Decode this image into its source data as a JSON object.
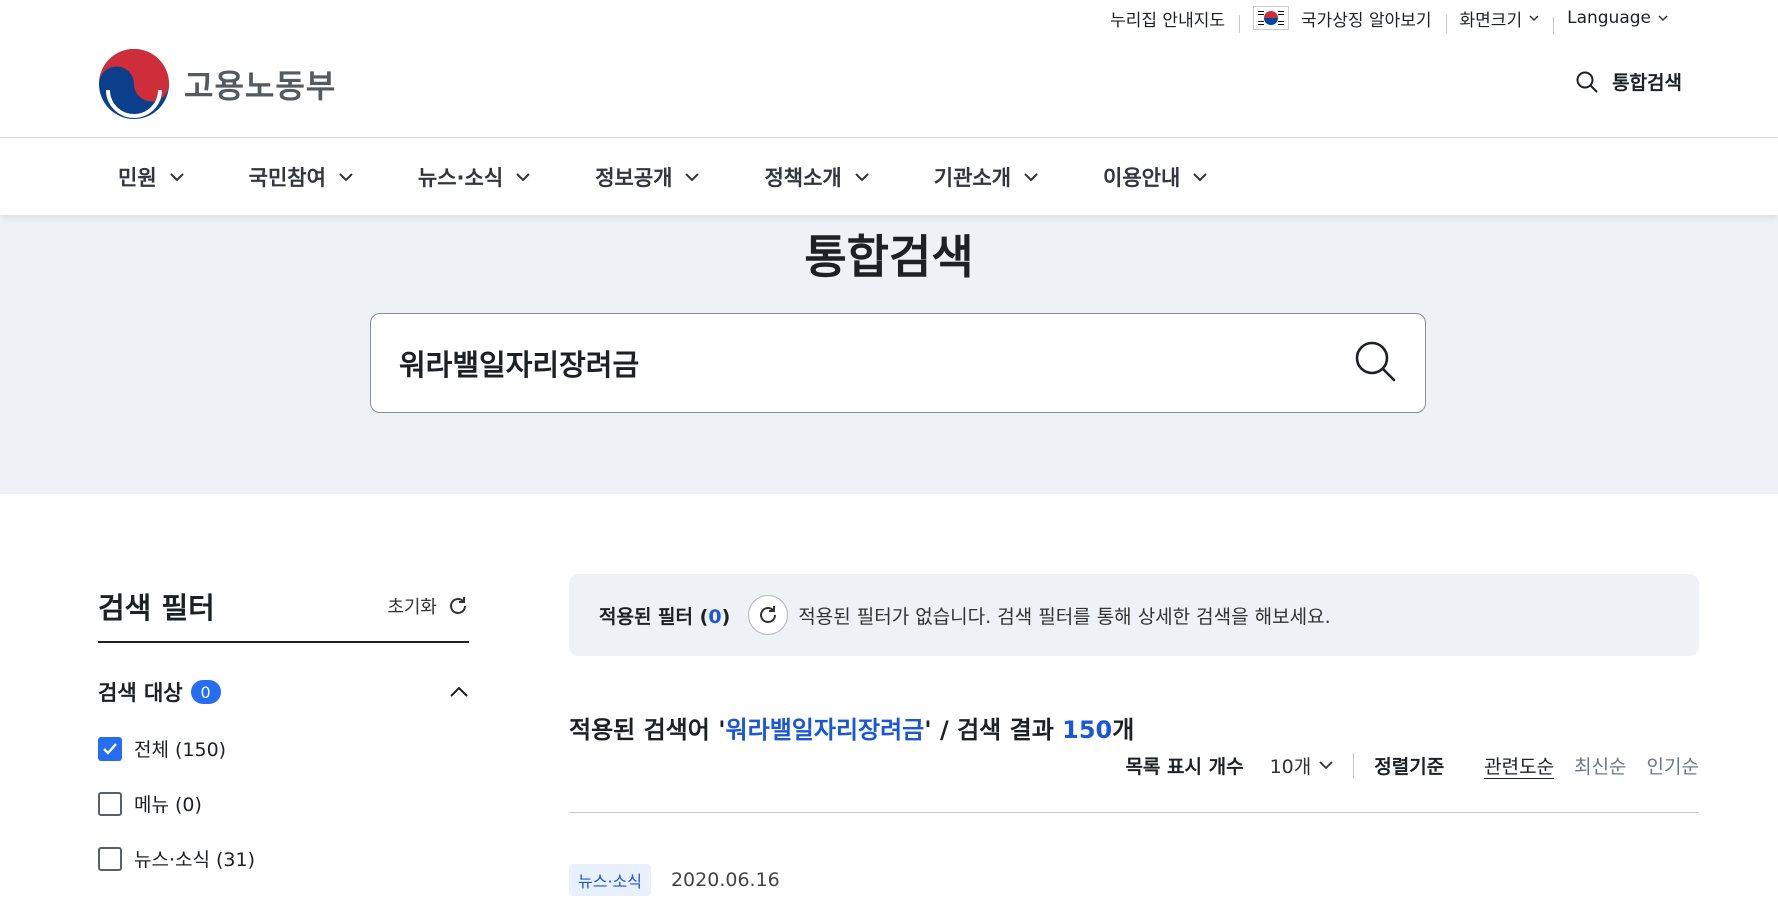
{
  "utility": {
    "sitemap": "누리집 안내지도",
    "symbols": "국가상징 알아보기",
    "font_size": "화면크기",
    "language": "Language"
  },
  "header": {
    "logo_text": "고용노동부",
    "search_label": "통합검색"
  },
  "gnb": [
    {
      "label": "민원"
    },
    {
      "label": "국민참여"
    },
    {
      "label": "뉴스·소식"
    },
    {
      "label": "정보공개"
    },
    {
      "label": "정책소개"
    },
    {
      "label": "기관소개"
    },
    {
      "label": "이용안내"
    }
  ],
  "hero": {
    "title": "통합검색",
    "query": "워라밸일자리장려금"
  },
  "sidebar": {
    "title": "검색 필터",
    "reset_label": "초기화",
    "section_title": "검색 대상",
    "section_count": "0",
    "options": [
      {
        "label": "전체 (150)",
        "checked": true
      },
      {
        "label": "메뉴 (0)",
        "checked": false
      },
      {
        "label": "뉴스·소식 (31)",
        "checked": false
      }
    ]
  },
  "applied": {
    "label_prefix": "적용된 필터 (",
    "count": "0",
    "label_suffix": ")",
    "message": "적용된 필터가 없습니다. 검색 필터를 통해 상세한 검색을 해보세요."
  },
  "summary": {
    "prefix": "적용된 검색어 '",
    "query": "워라밸일자리장려금",
    "middle": "' / 검색 결과 ",
    "count": "150",
    "suffix": "개"
  },
  "controls": {
    "page_size_label": "목록 표시 개수",
    "page_size_value": "10개",
    "sort_label": "정렬기준",
    "sort_options": [
      "관련도순",
      "최신순",
      "인기순"
    ]
  },
  "results": [
    {
      "category": "뉴스·소식",
      "date": "2020.06.16"
    }
  ]
}
